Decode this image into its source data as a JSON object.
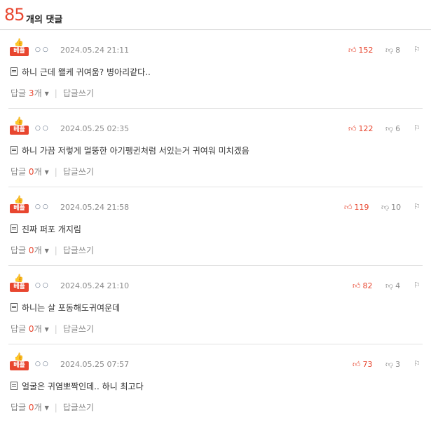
{
  "header": {
    "count": "85",
    "label": "개의 댓글"
  },
  "best_label": "베플",
  "dots": "○○",
  "reply_label": "답글",
  "reply_unit": "개",
  "write_label": "답글쓰기",
  "comments": [
    {
      "date": "2024.05.24 21:11",
      "likes": "152",
      "dislikes": "8",
      "text": "하니 근데 왤케 귀여움? 병아리같다..",
      "replies": "3"
    },
    {
      "date": "2024.05.25 02:35",
      "likes": "122",
      "dislikes": "6",
      "text": "하니 가끔 저렇게 멀뚱한 아기펭귄처럼 서있는거 귀여워 미치겠음",
      "replies": "0"
    },
    {
      "date": "2024.05.24 21:58",
      "likes": "119",
      "dislikes": "10",
      "text": "진짜 퍼포 개지림",
      "replies": "0"
    },
    {
      "date": "2024.05.24 21:10",
      "likes": "82",
      "dislikes": "4",
      "text": "하니는 살 포동해도귀여운데",
      "replies": "0"
    },
    {
      "date": "2024.05.25 07:57",
      "likes": "73",
      "dislikes": "3",
      "text": "얼굴은 귀염뽀짝인데.. 하니 최고다",
      "replies": "0"
    }
  ],
  "colors": {
    "accent": "#e8462f",
    "muted": "#8b8b8b"
  }
}
